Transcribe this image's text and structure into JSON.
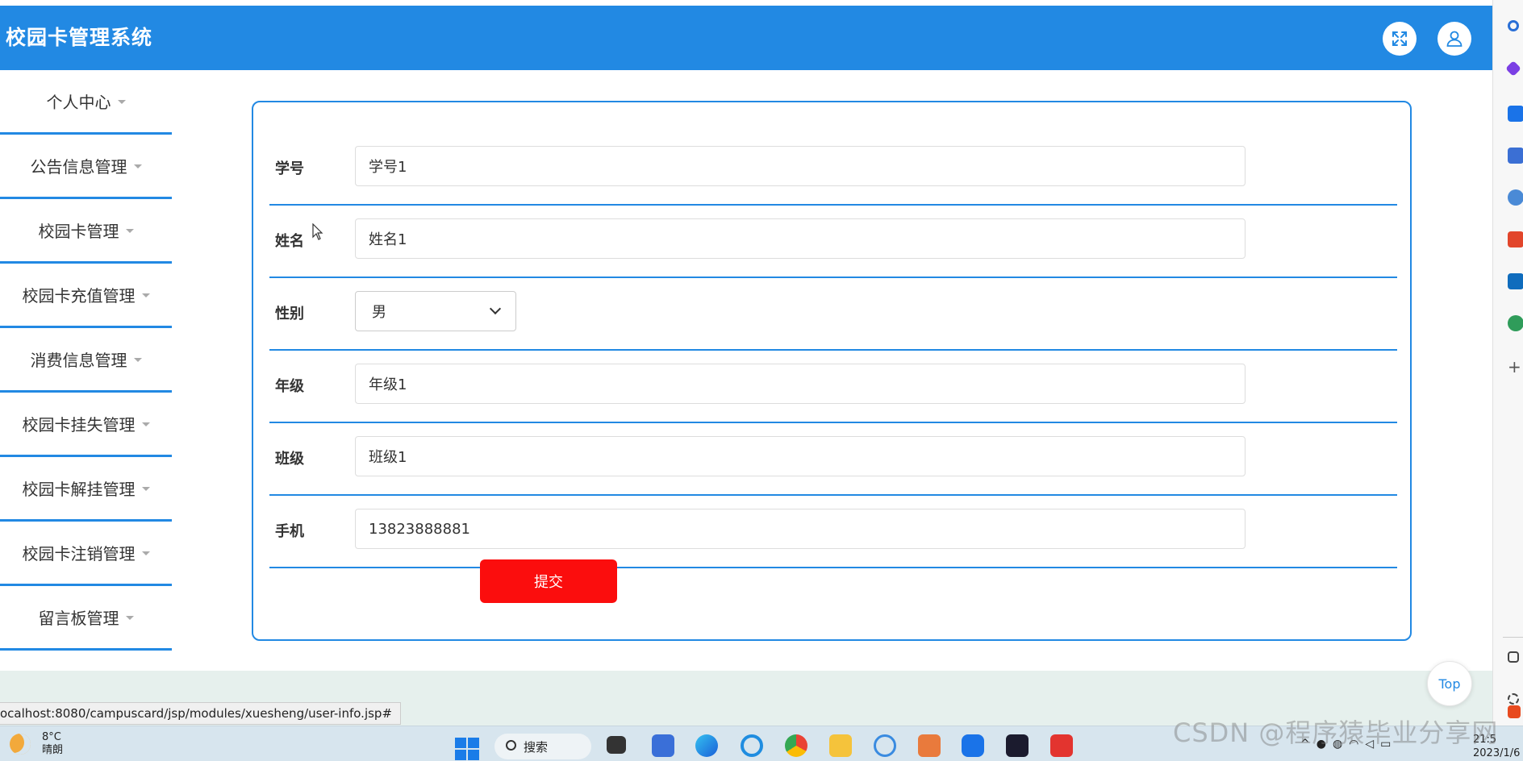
{
  "app": {
    "title": "校园卡管理系统"
  },
  "header": {
    "fullscreen_icon": "expand-icon",
    "user_icon": "user-icon"
  },
  "sidebar": {
    "items": [
      {
        "label": "个人中心"
      },
      {
        "label": "公告信息管理"
      },
      {
        "label": "校园卡管理"
      },
      {
        "label": "校园卡充值管理"
      },
      {
        "label": "消费信息管理"
      },
      {
        "label": "校园卡挂失管理"
      },
      {
        "label": "校园卡解挂管理"
      },
      {
        "label": "校园卡注销管理"
      },
      {
        "label": "留言板管理"
      }
    ]
  },
  "form": {
    "fields": [
      {
        "label": "学号",
        "value": "学号1"
      },
      {
        "label": "姓名",
        "value": "姓名1"
      },
      {
        "label": "性别",
        "value": "男"
      },
      {
        "label": "年级",
        "value": "年级1"
      },
      {
        "label": "班级",
        "value": "班级1"
      },
      {
        "label": "手机",
        "value": "13823888881"
      }
    ],
    "submit_label": "提交"
  },
  "top_button": "Top",
  "status_url": "ocalhost:8080/campuscard/jsp/modules/xuesheng/user-info.jsp#",
  "taskbar": {
    "weather_temp": "8°C",
    "weather_desc": "晴朗",
    "search_label": "搜索",
    "clock_time": "21:5",
    "clock_date": "2023/1/6"
  },
  "watermark": "CSDN @程序猿毕业分享网",
  "colors": {
    "primary": "#2289e3",
    "submit": "#fb0d0d"
  }
}
